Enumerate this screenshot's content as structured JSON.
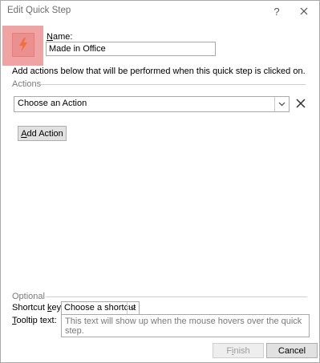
{
  "window": {
    "title": "Edit Quick Step",
    "help_label": "?",
    "close_label": "✕"
  },
  "quickstep": {
    "icon": "lightning-icon",
    "name_label_mnemonic": "N",
    "name_label_rest": "ame:",
    "name_value": "Made in Office"
  },
  "instruction": "Add actions below that will be performed when this quick step is clicked on.",
  "actions": {
    "group_label": "Actions",
    "selected_action": "Choose an Action",
    "add_action_mnemonic": "A",
    "add_action_rest": "dd Action"
  },
  "optional": {
    "group_label": "Optional",
    "shortcut_label_pre": "Shortcut ",
    "shortcut_label_mnemonic": "k",
    "shortcut_label_post": "ey:",
    "shortcut_value": "Choose a shortcut",
    "tooltip_label_mnemonic": "T",
    "tooltip_label_rest": "ooltip text:",
    "tooltip_value": "This text will show up when the mouse hovers over the quick step."
  },
  "buttons": {
    "finish_pre": "F",
    "finish_mnemonic": "i",
    "finish_post": "nish",
    "cancel": "Cancel"
  },
  "colors": {
    "icon_highlight": "#f0a3a3",
    "lightning": "#f26f3a"
  }
}
